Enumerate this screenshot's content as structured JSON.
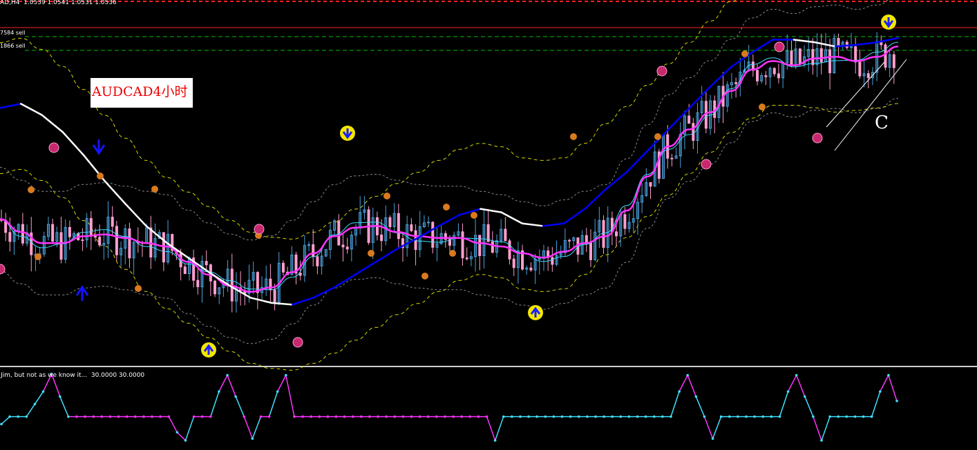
{
  "header": {
    "symbol_text": "AD,H4  1.0539 1.0541 1.0531 1.0536"
  },
  "levels": [
    {
      "label": "7584 sell",
      "color": "#00c000"
    },
    {
      "label": "1866 sell",
      "color": "#00c000"
    }
  ],
  "annotation": {
    "text": "AUDCAD4小时",
    "wave_label": "C"
  },
  "indicator": {
    "label": "Jim, but not as we know it...  30.0000 30.0000"
  },
  "colors": {
    "bull_candle": "#4aa3df",
    "bear_candle": "#ff9fcf",
    "slow_ma_up": "#0000ff",
    "slow_ma_down": "#ffffff",
    "fast_ma": "#ff33ff",
    "thin_ma": "#40e0ff",
    "band_yellow": "#d8d800",
    "band_gray": "#8a8a8a",
    "resistance": "#ff2020"
  },
  "chart_data": {
    "type": "line",
    "series": [
      {
        "name": "",
        "key": "fast_ma",
        "values": [
          1.029,
          1.0275,
          1.0262,
          1.0262,
          1.027,
          1.0272,
          1.0268,
          1.0262,
          1.0258,
          1.024,
          1.0225,
          1.0212,
          1.0205,
          1.021,
          1.0228,
          1.025,
          1.027,
          1.028,
          1.0282,
          1.0275,
          1.027,
          1.0268,
          1.0268,
          1.0262,
          1.0258,
          1.025,
          1.0245,
          1.0252,
          1.0262,
          1.027,
          1.03,
          1.034,
          1.0375,
          1.0395,
          1.0415,
          1.044,
          1.0465,
          1.0475,
          1.047,
          1.0478,
          1.048,
          1.0475,
          1.048,
          1.0492
        ]
      },
      {
        "name": "",
        "key": "slow_ma",
        "values": [
          1.042,
          1.0425,
          1.0412,
          1.0392,
          1.0365,
          1.0335,
          1.0308,
          1.0282,
          1.0262,
          1.0245,
          1.0228,
          1.0212,
          1.0198,
          1.0192,
          1.019,
          1.0198,
          1.021,
          1.0225,
          1.024,
          1.0255,
          1.0268,
          1.0282,
          1.0295,
          1.0302,
          1.0298,
          1.0285,
          1.0282,
          1.0285,
          1.0302,
          1.0325,
          1.0345,
          1.037,
          1.0395,
          1.042,
          1.0445,
          1.0468,
          1.0485,
          1.05,
          1.05,
          1.0497,
          1.0492,
          1.0494,
          1.0497,
          1.0502
        ]
      }
    ],
    "ylim": [
      1.012,
      1.054
    ],
    "grid": false,
    "oscillator": {
      "levels": [
        30,
        70
      ],
      "values": [
        18,
        30,
        30,
        30,
        50,
        70,
        98,
        62,
        30,
        30,
        30,
        30,
        30,
        30,
        30,
        30,
        30,
        30,
        30,
        30,
        30,
        5,
        -8,
        30,
        30,
        30,
        70,
        96,
        62,
        30,
        -5,
        30,
        30,
        70,
        96,
        30,
        30,
        30,
        30,
        30,
        30,
        30,
        30,
        30,
        30,
        30,
        30,
        30,
        30,
        30,
        30,
        30,
        30,
        30,
        30,
        30,
        30,
        30,
        30,
        -8,
        30,
        30,
        30,
        30,
        30,
        30,
        30,
        30,
        30,
        30,
        30,
        30,
        30,
        30,
        30,
        30,
        30,
        30,
        30,
        30,
        30,
        70,
        96,
        62,
        30,
        -5,
        30,
        30,
        30,
        30,
        30,
        30,
        30,
        30,
        70,
        96,
        62,
        30,
        -8,
        30,
        30,
        30,
        30,
        30,
        30,
        70,
        96,
        55
      ]
    }
  }
}
